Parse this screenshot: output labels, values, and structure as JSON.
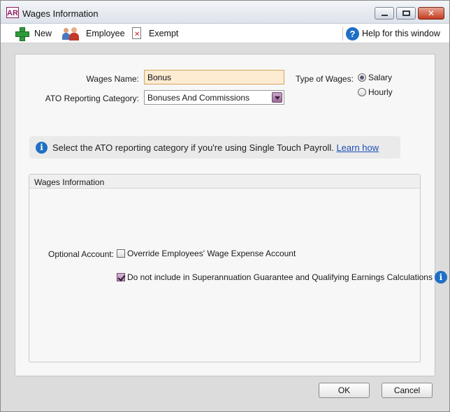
{
  "window": {
    "logo": "AR",
    "title": "Wages Information",
    "close_glyph": "✕"
  },
  "toolbar": {
    "new_label": "New",
    "employee_label": "Employee",
    "exempt_label": "Exempt",
    "help_label": "Help for this window",
    "help_glyph": "?"
  },
  "form": {
    "wages_name_label": "Wages Name:",
    "wages_name_value": "Bonus",
    "ato_label": "ATO Reporting Category:",
    "ato_value": "Bonuses And Commissions",
    "type_label": "Type of Wages:",
    "type_options": [
      {
        "label": "Salary",
        "selected": true
      },
      {
        "label": "Hourly",
        "selected": false
      }
    ]
  },
  "info_bar": {
    "glyph": "i",
    "text": "Select the ATO reporting category if you're using Single Touch Payroll. ",
    "link": "Learn how"
  },
  "wages_group": {
    "title": "Wages Information",
    "optional_label": "Optional Account:",
    "override_label": "Override Employees' Wage Expense Account",
    "override_checked": false,
    "super_label": "Do not include in Superannuation Guarantee and Qualifying Earnings Calculations",
    "super_checked": true,
    "super_info_glyph": "i"
  },
  "buttons": {
    "ok": "OK",
    "cancel": "Cancel"
  },
  "colors": {
    "accent_purple": "#9b6b9b",
    "info_blue": "#1f6fc4",
    "input_highlight": "#fdecd2"
  }
}
